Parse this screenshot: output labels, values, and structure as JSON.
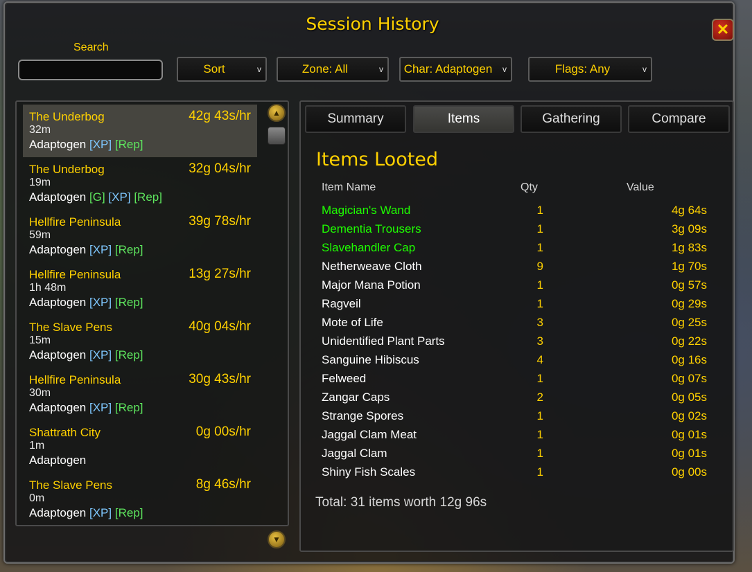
{
  "window": {
    "title": "Session History",
    "close_label": "✕"
  },
  "search": {
    "label": "Search",
    "value": ""
  },
  "filters": {
    "sort": {
      "label": "Sort",
      "chevron": "v"
    },
    "zone": {
      "label": "Zone: All",
      "chevron": "v"
    },
    "char": {
      "label": "Char: Adaptogen",
      "chevron": "v"
    },
    "flags": {
      "label": "Flags: Any",
      "chevron": "v"
    }
  },
  "sessions": [
    {
      "zone": "The Underbog",
      "rate": "42g 43s/hr",
      "duration": "32m",
      "char": "Adaptogen",
      "tags": [
        "XP",
        "Rep"
      ],
      "selected": true
    },
    {
      "zone": "The Underbog",
      "rate": "32g 04s/hr",
      "duration": "19m",
      "char": "Adaptogen",
      "tags": [
        "G",
        "XP",
        "Rep"
      ]
    },
    {
      "zone": "Hellfire Peninsula",
      "rate": "39g 78s/hr",
      "duration": "59m",
      "char": "Adaptogen",
      "tags": [
        "XP",
        "Rep"
      ]
    },
    {
      "zone": "Hellfire Peninsula",
      "rate": "13g 27s/hr",
      "duration": "1h 48m",
      "char": "Adaptogen",
      "tags": [
        "XP",
        "Rep"
      ]
    },
    {
      "zone": "The Slave Pens",
      "rate": "40g 04s/hr",
      "duration": "15m",
      "char": "Adaptogen",
      "tags": [
        "XP",
        "Rep"
      ]
    },
    {
      "zone": "Hellfire Peninsula",
      "rate": "30g 43s/hr",
      "duration": "30m",
      "char": "Adaptogen",
      "tags": [
        "XP",
        "Rep"
      ]
    },
    {
      "zone": "Shattrath City",
      "rate": "0g 00s/hr",
      "duration": "1m",
      "char": "Adaptogen",
      "tags": []
    },
    {
      "zone": "The Slave Pens",
      "rate": "8g 46s/hr",
      "duration": "0m",
      "char": "Adaptogen",
      "tags": [
        "XP",
        "Rep"
      ]
    }
  ],
  "tabs": [
    {
      "label": "Summary",
      "active": false
    },
    {
      "label": "Items",
      "active": true
    },
    {
      "label": "Gathering",
      "active": false
    },
    {
      "label": "Compare",
      "active": false
    }
  ],
  "items_panel": {
    "title": "Items Looted",
    "col_name": "Item Name",
    "col_qty": "Qty",
    "col_value": "Value",
    "items": [
      {
        "name": "Magician's Wand",
        "qty": "1",
        "value": "4g 64s",
        "quality": "green"
      },
      {
        "name": "Dementia Trousers",
        "qty": "1",
        "value": "3g 09s",
        "quality": "green"
      },
      {
        "name": "Slavehandler Cap",
        "qty": "1",
        "value": "1g 83s",
        "quality": "green"
      },
      {
        "name": "Netherweave Cloth",
        "qty": "9",
        "value": "1g 70s",
        "quality": "white"
      },
      {
        "name": "Major Mana Potion",
        "qty": "1",
        "value": "0g 57s",
        "quality": "white"
      },
      {
        "name": "Ragveil",
        "qty": "1",
        "value": "0g 29s",
        "quality": "white"
      },
      {
        "name": "Mote of Life",
        "qty": "3",
        "value": "0g 25s",
        "quality": "white"
      },
      {
        "name": "Unidentified Plant Parts",
        "qty": "3",
        "value": "0g 22s",
        "quality": "white"
      },
      {
        "name": "Sanguine Hibiscus",
        "qty": "4",
        "value": "0g 16s",
        "quality": "white"
      },
      {
        "name": "Felweed",
        "qty": "1",
        "value": "0g 07s",
        "quality": "white"
      },
      {
        "name": "Zangar Caps",
        "qty": "2",
        "value": "0g 05s",
        "quality": "white"
      },
      {
        "name": "Strange Spores",
        "qty": "1",
        "value": "0g 02s",
        "quality": "white"
      },
      {
        "name": "Jaggal Clam Meat",
        "qty": "1",
        "value": "0g 01s",
        "quality": "white"
      },
      {
        "name": "Jaggal Clam",
        "qty": "1",
        "value": "0g 01s",
        "quality": "white"
      },
      {
        "name": "Shiny Fish Scales",
        "qty": "1",
        "value": "0g 00s",
        "quality": "white"
      }
    ],
    "total": "Total: 31 items worth 12g 96s"
  },
  "colors": {
    "gold": "#ffd100",
    "uncommon": "#1eff00",
    "xp_tag": "#7fc8ff",
    "rep_tag": "#5ee65e"
  },
  "icons": {
    "close": "close-icon",
    "scroll_up": "scroll-up-icon",
    "scroll_down": "scroll-down-icon",
    "chevron": "chevron-down-icon"
  }
}
